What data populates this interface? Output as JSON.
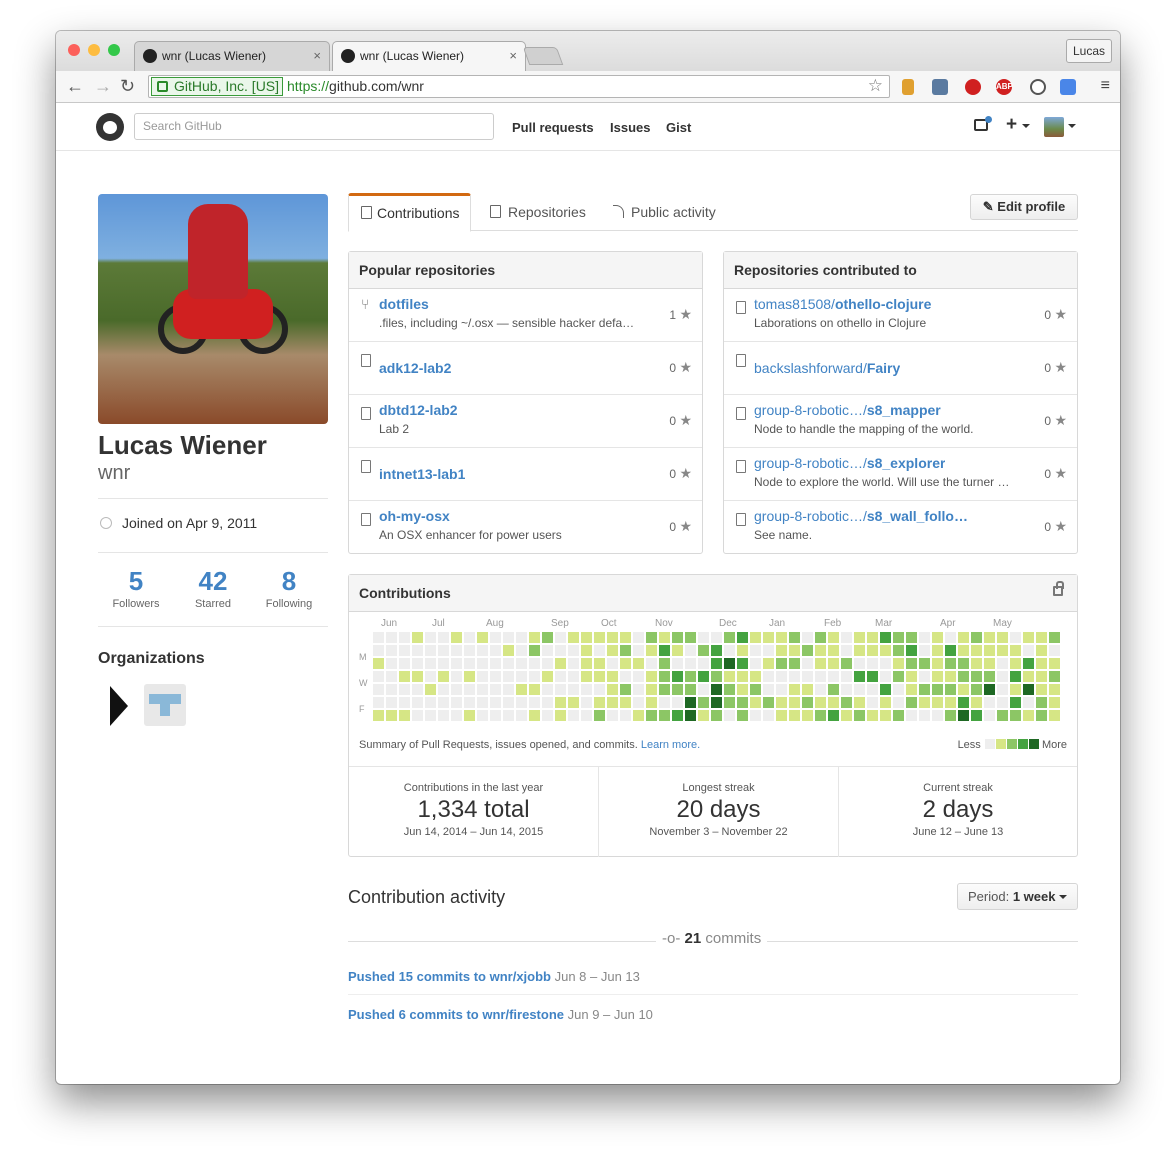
{
  "browser": {
    "tabs": [
      {
        "title": "wnr (Lucas Wiener)",
        "close": "×"
      },
      {
        "title": "wnr (Lucas Wiener)",
        "close": "×"
      }
    ],
    "user_button": "Lucas",
    "security_label": "GitHub, Inc. [US]",
    "url_protocol": "https://",
    "url_rest": "github.com/wnr",
    "nav": {
      "back": "←",
      "forward": "→",
      "reload": "↻",
      "bookmark": "☆",
      "menu": "≡"
    },
    "extensions": [
      "bookmark-ext-icon",
      "screenshot-ext-icon",
      "stop-ext-icon",
      "adblock-ext-icon",
      "info-ext-icon",
      "translate-ext-icon"
    ],
    "extension_labels": {
      "abp": "ABP"
    }
  },
  "gh_header": {
    "search_placeholder": "Search GitHub",
    "links": [
      "Pull requests",
      "Issues",
      "Gist"
    ],
    "plus": "+"
  },
  "profile": {
    "name": "Lucas Wiener",
    "login": "wnr",
    "joined": "Joined on Apr 9, 2011",
    "stats": [
      {
        "value": "5",
        "label": "Followers"
      },
      {
        "value": "42",
        "label": "Starred"
      },
      {
        "value": "8",
        "label": "Following"
      }
    ],
    "organizations_title": "Organizations"
  },
  "tabs": [
    "Contributions",
    "Repositories",
    "Public activity"
  ],
  "edit_profile": "✎ Edit profile",
  "popular": {
    "title": "Popular repositories",
    "repos": [
      {
        "name": "dotfiles",
        "desc": ".files, including ~/.osx — sensible hacker defa…",
        "stars": "1",
        "icon": "fork-icon"
      },
      {
        "name": "adk12-lab2",
        "desc": "",
        "stars": "0",
        "icon": "repo-icon"
      },
      {
        "name": "dbtd12-lab2",
        "desc": "Lab 2",
        "stars": "0",
        "icon": "repo-icon"
      },
      {
        "name": "intnet13-lab1",
        "desc": "",
        "stars": "0",
        "icon": "repo-icon"
      },
      {
        "name": "oh-my-osx",
        "desc": "An OSX enhancer for power users",
        "stars": "0",
        "icon": "repo-icon"
      }
    ]
  },
  "contributed": {
    "title": "Repositories contributed to",
    "repos": [
      {
        "owner": "tomas81508/",
        "name": "othello-clojure",
        "desc": "Laborations on othello in Clojure",
        "stars": "0"
      },
      {
        "owner": "backslashforward/",
        "name": "Fairy",
        "desc": "",
        "stars": "0"
      },
      {
        "owner": "group-8-robotic…/",
        "name": "s8_mapper",
        "desc": "Node to handle the mapping of the world.",
        "stars": "0"
      },
      {
        "owner": "group-8-robotic…/",
        "name": "s8_explorer",
        "desc": "Node to explore the world. Will use the turner …",
        "stars": "0"
      },
      {
        "owner": "group-8-robotic…/",
        "name": "s8_wall_follo…",
        "desc": "See name.",
        "stars": "0"
      }
    ]
  },
  "star_glyph": "★",
  "contributions": {
    "title": "Contributions",
    "months": [
      "Jun",
      "Jul",
      "Aug",
      "Sep",
      "Oct",
      "Nov",
      "Dec",
      "Jan",
      "Feb",
      "Mar",
      "Apr",
      "May"
    ],
    "days": [
      "M",
      "W",
      "F"
    ],
    "summary": "Summary of Pull Requests, issues opened, and commits.",
    "learn_more": "Learn more.",
    "legend_less": "Less",
    "legend_more": "More",
    "colors": [
      "#eeeeee",
      "#d6e685",
      "#8cc665",
      "#44a340",
      "#1e6823"
    ],
    "streaks": [
      {
        "title": "Contributions in the last year",
        "value": "1,334 total",
        "range": "Jun 14, 2014 – Jun 14, 2015"
      },
      {
        "title": "Longest streak",
        "value": "20 days",
        "range": "November 3 – November 22"
      },
      {
        "title": "Current streak",
        "value": "2 days",
        "range": "June 12 – June 13"
      }
    ]
  },
  "activity": {
    "title": "Contribution activity",
    "period_label": "Period:",
    "period_value": "1 week",
    "commits_count": "21",
    "commits_label": "commits",
    "pushes": [
      {
        "link": "Pushed 15 commits to wnr/xjobb",
        "range": "Jun 8 – Jun 13"
      },
      {
        "link": "Pushed 6 commits to wnr/firestone",
        "range": "Jun 9 – Jun 10"
      }
    ]
  }
}
